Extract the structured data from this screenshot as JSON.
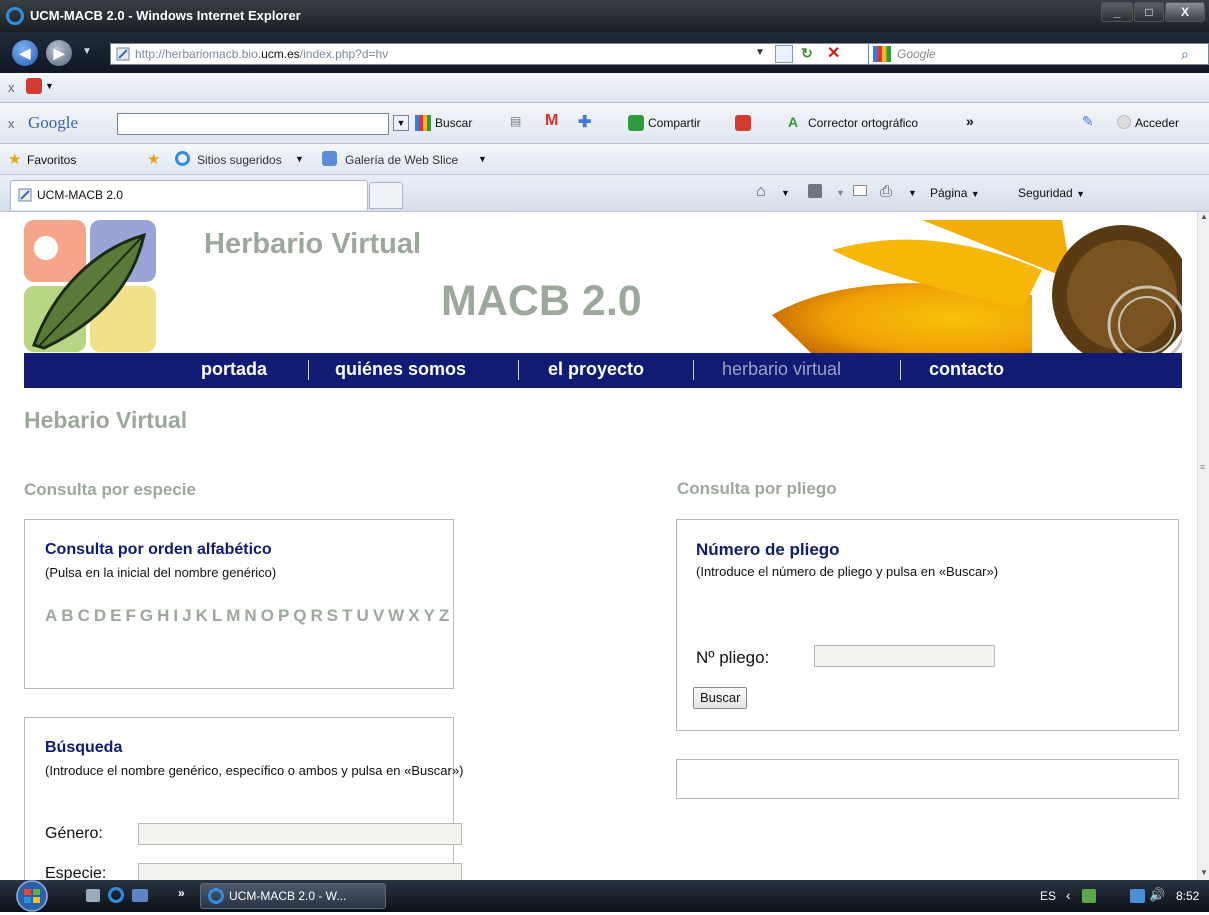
{
  "window": {
    "title": "UCM-MACB 2.0 - Windows Internet Explorer",
    "minimize": "_",
    "maximize": "□",
    "close": "X"
  },
  "address_bar": {
    "url_prefix": "http://herbariomacb.bio.",
    "url_domain": "ucm.es",
    "url_suffix": "/index.php?d=hv",
    "search_placeholder": "Google"
  },
  "google_toolbar": {
    "brand": "Google",
    "buscar": "Buscar",
    "compartir": "Compartir",
    "corrector": "Corrector ortográfico",
    "more": "»",
    "acceder": "Acceder"
  },
  "favorites_bar": {
    "favoritos": "Favoritos",
    "sitios": "Sitios sugeridos",
    "galeria": "Galería de Web Slice"
  },
  "tab_bar": {
    "active_tab": "UCM-MACB 2.0",
    "pagina": "Página",
    "seguridad": "Seguridad"
  },
  "site": {
    "title_line1": "Herbario Virtual",
    "title_line2": "MACB 2.0",
    "nav": [
      "portada",
      "quiénes somos",
      "el proyecto",
      "herbario virtual",
      "contacto"
    ],
    "page_heading": "Hebario Virtual",
    "especie": {
      "section_heading": "Consulta por especie",
      "alpha_title": "Consulta por orden alfabético",
      "alpha_sub": "(Pulsa en la inicial del nombre genérico)",
      "letters": [
        "A",
        "B",
        "C",
        "D",
        "E",
        "F",
        "G",
        "H",
        "I",
        "J",
        "K",
        "L",
        "M",
        "N",
        "O",
        "P",
        "Q",
        "R",
        "S",
        "T",
        "U",
        "V",
        "W",
        "X",
        "Y",
        "Z"
      ],
      "search_title": "Búsqueda",
      "search_sub": "(Introduce el nombre genérico, específico o ambos y pulsa en «Buscar»)",
      "genero_label": "Género:",
      "especie_label": "Especie:"
    },
    "pliego": {
      "section_heading": "Consulta por pliego",
      "title": "Número de pliego",
      "sub": "(Introduce el número de pliego y pulsa en «Buscar»)",
      "field_label": "Nº pliego:",
      "button": "Buscar"
    }
  },
  "taskbar": {
    "more": "»",
    "task": "UCM-MACB 2.0 - W...",
    "lang": "ES",
    "time": "8:52"
  }
}
